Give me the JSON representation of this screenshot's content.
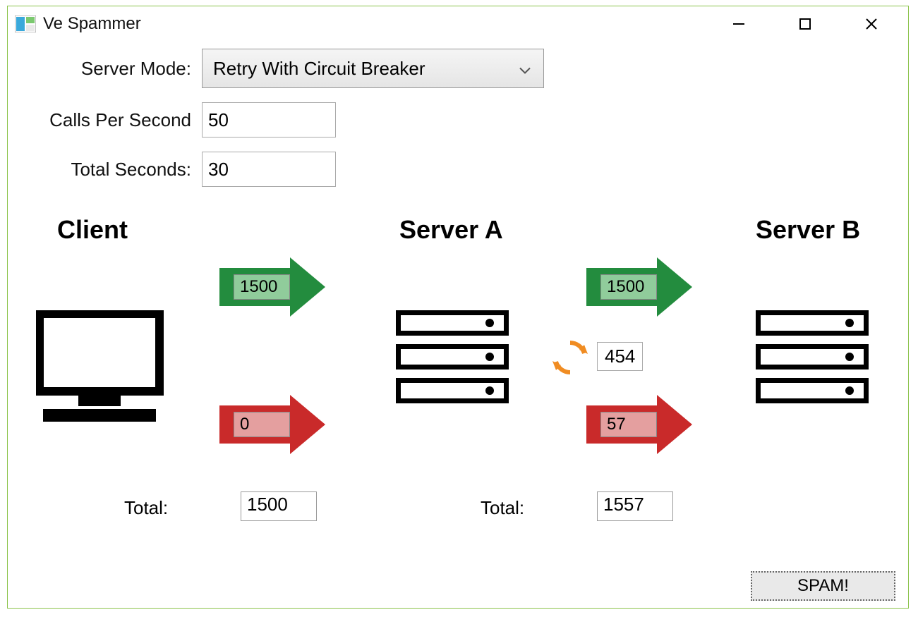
{
  "app_title": "Ve Spammer",
  "form": {
    "server_mode_label": "Server Mode:",
    "server_mode_value": "Retry With Circuit Breaker",
    "calls_per_second_label": "Calls Per Second",
    "calls_per_second_value": "50",
    "total_seconds_label": "Total Seconds:",
    "total_seconds_value": "30"
  },
  "headings": {
    "client": "Client",
    "server_a": "Server A",
    "server_b": "Server B"
  },
  "arrows": {
    "client_to_a_success": "1500",
    "client_to_a_fail": "0",
    "a_to_b_success": "1500",
    "a_to_b_retry": "454",
    "a_to_b_fail": "57"
  },
  "totals": {
    "label": "Total:",
    "client_total": "1500",
    "server_a_total": "1557"
  },
  "spam_button_label": "SPAM!",
  "colors": {
    "green": "#238c3e",
    "red": "#c92a2a",
    "retry_orange": "#f08c22"
  }
}
